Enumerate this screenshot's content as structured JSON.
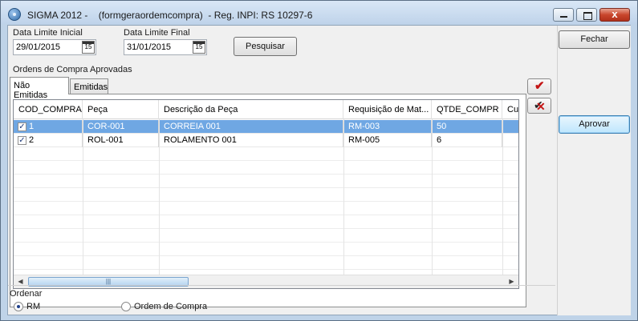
{
  "window": {
    "title": "SIGMA 2012 -    (formgeraordemcompra)  - Reg. INPI: RS 10297-6",
    "min_label": "",
    "max_label": "",
    "close_label": "x"
  },
  "filters": {
    "start_label": "Data Limite Inicial",
    "start_value": "29/01/2015",
    "end_label": "Data Limite Final",
    "end_value": "31/01/2015",
    "search_button": "Pesquisar",
    "calendar_glyph": "15"
  },
  "section_label": "Ordens de Compra Aprovadas",
  "tabs": [
    {
      "label": "Não Emitidas",
      "active": true
    },
    {
      "label": "Emitidas",
      "active": false
    }
  ],
  "grid": {
    "columns": [
      "COD_COMPRA",
      "Peça",
      "Descrição da Peça",
      "Requisição de Mat...",
      "QTDE_COMPR",
      "Cu"
    ],
    "rows": [
      {
        "checked": true,
        "selected": true,
        "cells": [
          "1",
          "COR-001",
          "CORREIA 001",
          "RM-003",
          "50",
          ""
        ]
      },
      {
        "checked": true,
        "selected": false,
        "cells": [
          "2",
          "ROL-001",
          "ROLAMENTO 001",
          "RM-005",
          "6",
          ""
        ]
      }
    ],
    "check_glyph": "✓",
    "scroll_left": "◀",
    "scroll_right": "▶",
    "scroll_thumb": "|||"
  },
  "side_icons": {
    "check_all": "✔",
    "uncheck_all_a": "✔",
    "uncheck_all_b": "✕"
  },
  "sidebar": {
    "close_button": "Fechar",
    "approve_button": "Aprovar"
  },
  "order": {
    "label": "Ordenar",
    "options": [
      {
        "label": "RM",
        "selected": true
      },
      {
        "label": "Ordem de Compra",
        "selected": false
      }
    ]
  }
}
